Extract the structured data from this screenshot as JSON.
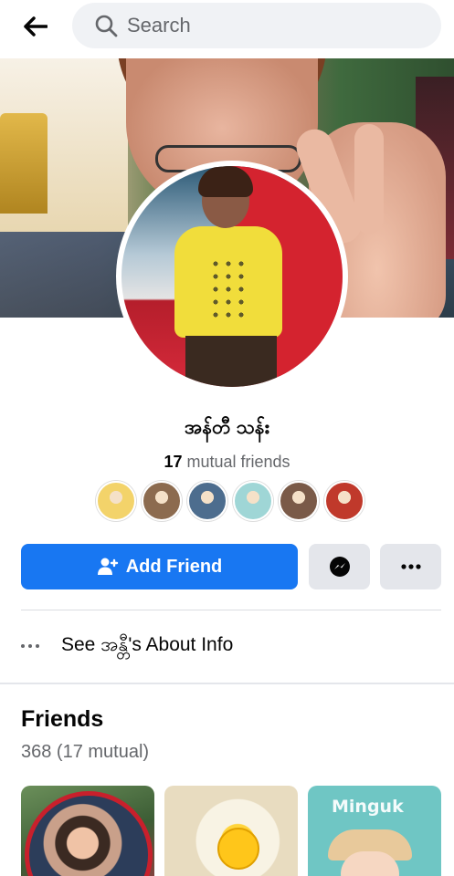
{
  "header": {
    "search_placeholder": "Search"
  },
  "profile": {
    "name": "အန်တီ သန်း",
    "mutual_count": "17",
    "mutual_label": "mutual friends"
  },
  "actions": {
    "add_friend_label": "Add Friend"
  },
  "about": {
    "label": "See အန္တီ's About Info"
  },
  "friends": {
    "title": "Friends",
    "count": "368 (17 mutual)",
    "tiles": [
      {
        "label": ""
      },
      {
        "label": ""
      },
      {
        "label": "Minguk"
      }
    ]
  },
  "colors": {
    "accent": "#1877f2",
    "secondary_button": "#e4e6eb",
    "muted_text": "#65676b"
  },
  "mutual_avatars": [
    {
      "color": "#f3d36a"
    },
    {
      "color": "#8c6b4f"
    },
    {
      "color": "#4d6d8e"
    },
    {
      "color": "#9fd6d6"
    },
    {
      "color": "#7a5a48"
    },
    {
      "color": "#c0392b"
    }
  ]
}
